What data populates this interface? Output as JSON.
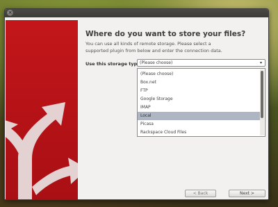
{
  "window": {
    "close_glyph": "×"
  },
  "page": {
    "heading": "Where do you want to store your files?",
    "description": "You can use all kinds of remote storage. Please select a supported plugin from below and enter the connection data."
  },
  "storage": {
    "label": "Use this storage type:",
    "selected_value": "(Please choose)",
    "arrow_glyph": "▾",
    "options": [
      {
        "label": "(Please choose)",
        "selected": false
      },
      {
        "label": "Box.net",
        "selected": false
      },
      {
        "label": "FTP",
        "selected": false
      },
      {
        "label": "Google Storage",
        "selected": false
      },
      {
        "label": "IMAP",
        "selected": false
      },
      {
        "label": "Local",
        "selected": true
      },
      {
        "label": "Picasa",
        "selected": false
      },
      {
        "label": "Rackspace Cloud Files",
        "selected": false
      }
    ]
  },
  "buttons": {
    "back_label": "< Back",
    "next_label": "Next >"
  },
  "colors": {
    "accent_red": "#c3161a",
    "selection": "#aeb6c4"
  },
  "icons": {
    "side_graphic": "branching-arrows-icon",
    "close": "close-icon",
    "dropdown": "chevron-down-icon"
  }
}
